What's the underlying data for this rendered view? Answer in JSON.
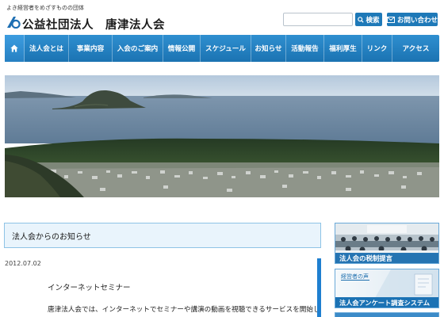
{
  "header": {
    "tagline": "よき経営者をめざすものの団体",
    "title": "公益社団法人　唐津法人会",
    "search_placeholder": "",
    "search_label": "検索",
    "contact_label": "お問い合わせ"
  },
  "nav": {
    "items": [
      {
        "label": "法人会とは"
      },
      {
        "label": "事業内容"
      },
      {
        "label": "入会のご案内"
      },
      {
        "label": "情報公開"
      },
      {
        "label": "スケジュール"
      },
      {
        "label": "お知らせ"
      },
      {
        "label": "活動報告"
      },
      {
        "label": "福利厚生"
      },
      {
        "label": "リンク"
      },
      {
        "label": "アクセス"
      }
    ]
  },
  "notice": {
    "title": "法人会からのお知らせ",
    "date": "2012.07.02",
    "heading": "インターネットセミナー",
    "body": "唐津法人会では、インターネットでセミナーや講演の動画を視聴できるサービスを開始し"
  },
  "sidebar": {
    "banner1_label": "法人会の税制提言",
    "banner2_sub": "経営者の声",
    "banner2_label": "法人会アンケート調査システム"
  },
  "colors": {
    "accent": "#1e79b8",
    "nav_bg": "#2485c6",
    "notice_bg": "#e9f4fc"
  },
  "icons": [
    "logo-icon",
    "search-icon",
    "mail-icon",
    "home-icon"
  ]
}
